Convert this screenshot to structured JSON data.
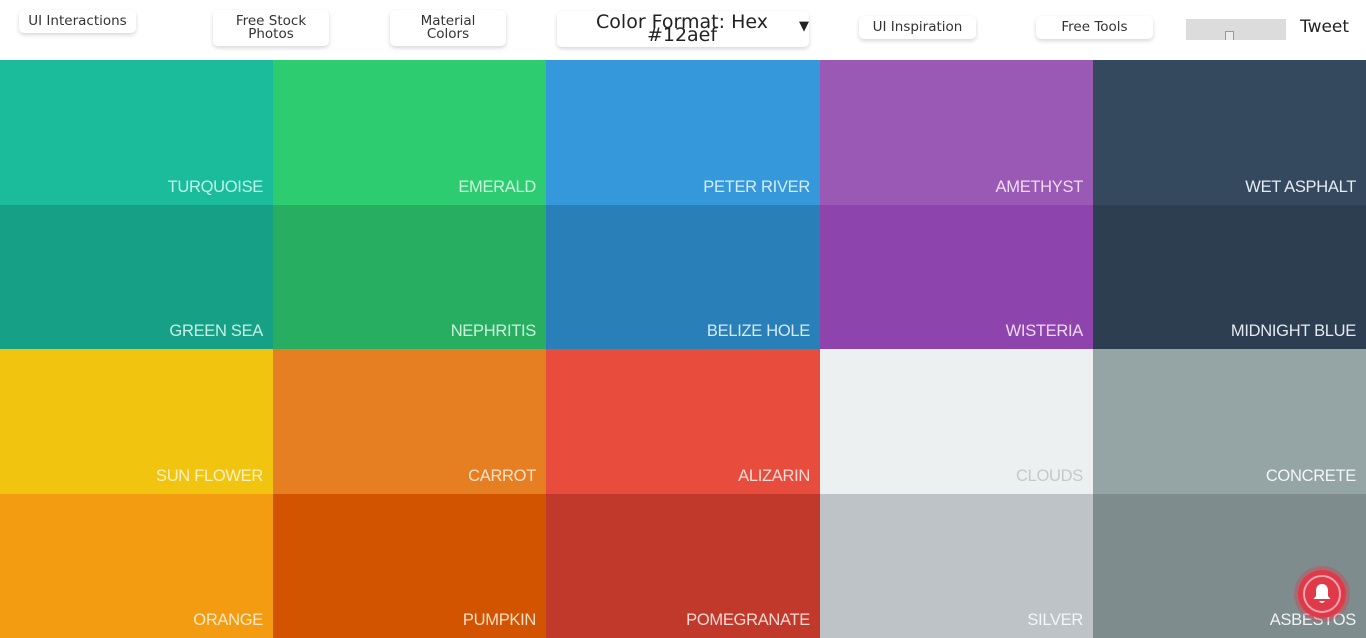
{
  "header": {
    "nav": [
      {
        "id": "ui-interactions",
        "label": "UI Interactions"
      },
      {
        "id": "free-stock-photos",
        "label": "Free Stock\nPhotos"
      },
      {
        "id": "material-colors",
        "label": "Material\nColors"
      },
      {
        "id": "ui-inspiration",
        "label": "UI Inspiration"
      },
      {
        "id": "free-tools",
        "label": "Free Tools"
      }
    ],
    "color_format": {
      "label": "Color Format: Hex #12aef",
      "caret": "▾"
    },
    "tweet_label": "Tweet",
    "image_placeholder_icon": "broken-image-icon"
  },
  "palette": [
    {
      "name": "Turquoise",
      "color": "#1abc9c",
      "label_color": "#bdf5ea"
    },
    {
      "name": "Emerald",
      "color": "#2ecc71",
      "label_color": "#c8f6dc"
    },
    {
      "name": "Peter River",
      "color": "#3498db",
      "label_color": "#d6ebfa"
    },
    {
      "name": "Amethyst",
      "color": "#9b59b6",
      "label_color": "#ecdcf2"
    },
    {
      "name": "Wet Asphalt",
      "color": "#34495e",
      "label_color": "#e6ecf2"
    },
    {
      "name": "Green Sea",
      "color": "#16a085",
      "label_color": "#c5f1e7"
    },
    {
      "name": "Nephritis",
      "color": "#27ae60",
      "label_color": "#cdf3dc"
    },
    {
      "name": "Belize Hole",
      "color": "#2980b9",
      "label_color": "#d5e9f7"
    },
    {
      "name": "Wisteria",
      "color": "#8e44ad",
      "label_color": "#ecdaf3"
    },
    {
      "name": "Midnight Blue",
      "color": "#2c3e50",
      "label_color": "#e4eaf0"
    },
    {
      "name": "Sun Flower",
      "color": "#f1c40f",
      "label_color": "#fdf1c0"
    },
    {
      "name": "Carrot",
      "color": "#e67e22",
      "label_color": "#fbe1c8"
    },
    {
      "name": "Alizarin",
      "color": "#e74c3c",
      "label_color": "#fbdcd8"
    },
    {
      "name": "Clouds",
      "color": "#ecf0f1",
      "label_color": "#c4c9cb"
    },
    {
      "name": "Concrete",
      "color": "#95a5a6",
      "label_color": "#f2f6f6"
    },
    {
      "name": "Orange",
      "color": "#f39c12",
      "label_color": "#fde8c4"
    },
    {
      "name": "Pumpkin",
      "color": "#d35400",
      "label_color": "#f9ddc6"
    },
    {
      "name": "Pomegranate",
      "color": "#c0392b",
      "label_color": "#f7d9d4"
    },
    {
      "name": "Silver",
      "color": "#bdc3c7",
      "label_color": "#f4f6f7"
    },
    {
      "name": "Asbestos",
      "color": "#7f8c8d",
      "label_color": "#eef2f2"
    }
  ],
  "notification": {
    "icon": "bell-icon",
    "color": "#e0394a"
  }
}
